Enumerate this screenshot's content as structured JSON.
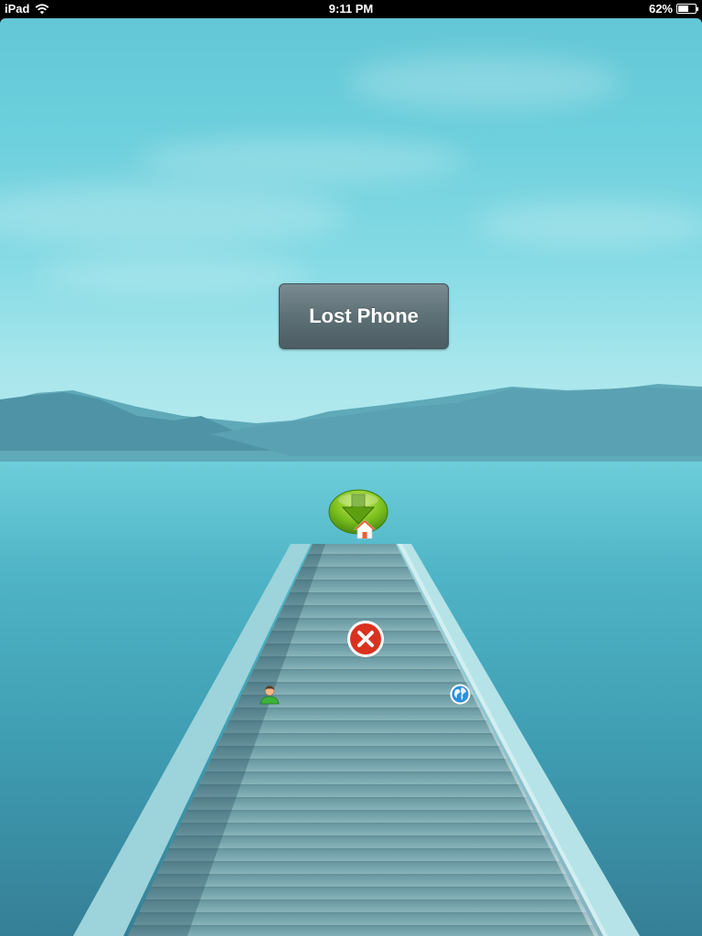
{
  "status_bar": {
    "device": "iPad",
    "time": "9:11 PM",
    "battery_text": "62%",
    "battery_level": 0.62
  },
  "main": {
    "lost_phone_button_label": "Lost Phone"
  },
  "icons": {
    "download": "download-arrow-icon",
    "home": "home-icon",
    "close": "close-icon",
    "contact": "person-icon",
    "web": "globe-icon",
    "wifi": "wifi-icon",
    "battery": "battery-icon"
  },
  "colors": {
    "sky": "#6ccfdc",
    "water": "#3f9db2",
    "button": "#5d7075",
    "download_green": "#7bbf1e",
    "close_red": "#d9321f"
  }
}
